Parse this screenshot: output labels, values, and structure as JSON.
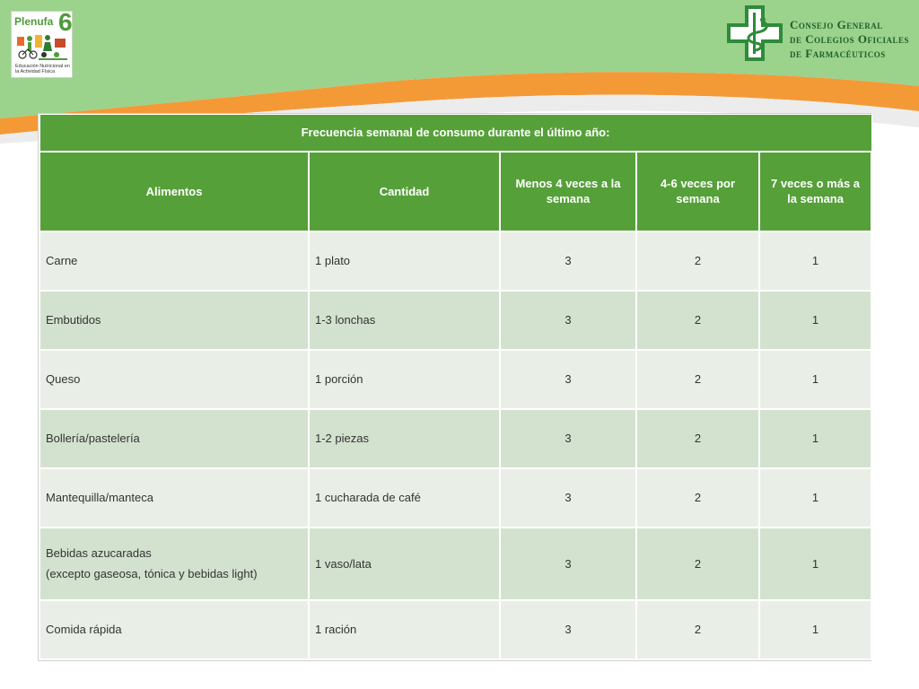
{
  "logos": {
    "left": {
      "title": "Plenufa",
      "number": "6",
      "subtitle": "Educación Nutricional en la Actividad Física"
    },
    "right": {
      "line1": "Consejo General",
      "line2": "de Colegios Oficiales",
      "line3": "de Farmacéuticos"
    }
  },
  "colors": {
    "green": "#56a03a",
    "light_green": "#9bd28c",
    "orange": "#f39a37",
    "row_odd": "#e9efe6",
    "row_even": "#d3e2cf"
  },
  "table": {
    "title": "Frecuencia semanal de consumo durante el último año:",
    "headers": [
      "Alimentos",
      "Cantidad",
      "Menos 4 veces a la semana",
      "4-6 veces por semana",
      "7 veces o más a la semana"
    ],
    "rows": [
      {
        "food": "Carne",
        "food_note": "",
        "amount": "1 plato",
        "less4": "3",
        "four_six": "2",
        "seven_plus": "1"
      },
      {
        "food": "Embutidos",
        "food_note": "",
        "amount": "1-3 lonchas",
        "less4": "3",
        "four_six": "2",
        "seven_plus": "1"
      },
      {
        "food": "Queso",
        "food_note": "",
        "amount": "1 porción",
        "less4": "3",
        "four_six": "2",
        "seven_plus": "1"
      },
      {
        "food": "Bollería/pastelería",
        "food_note": "",
        "amount": "1-2 piezas",
        "less4": "3",
        "four_six": "2",
        "seven_plus": "1"
      },
      {
        "food": "Mantequilla/manteca",
        "food_note": "",
        "amount": "1 cucharada de café",
        "less4": "3",
        "four_six": "2",
        "seven_plus": "1"
      },
      {
        "food": "Bebidas azucaradas",
        "food_note": "(excepto gaseosa, tónica y bebidas light)",
        "amount": "1 vaso/lata",
        "less4": "3",
        "four_six": "2",
        "seven_plus": "1"
      },
      {
        "food": "Comida rápida",
        "food_note": "",
        "amount": "1 ración",
        "less4": "3",
        "four_six": "2",
        "seven_plus": "1"
      }
    ]
  }
}
